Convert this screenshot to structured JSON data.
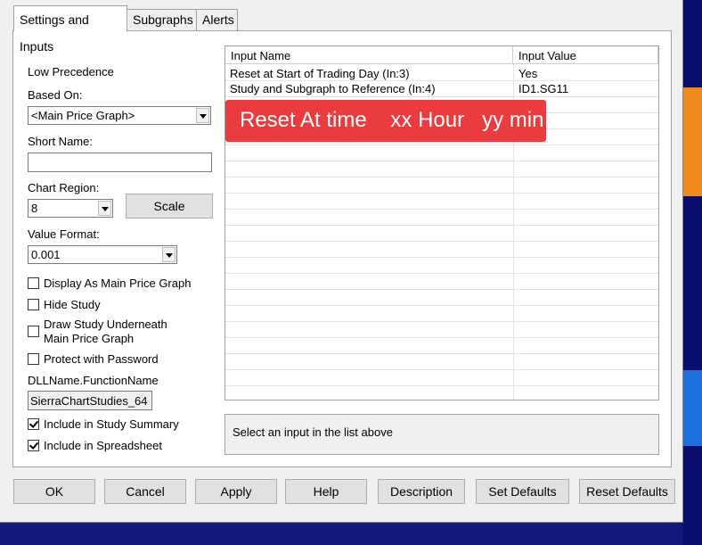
{
  "tabs": [
    "Settings and Inputs",
    "Subgraphs",
    "Alerts"
  ],
  "left": {
    "precedence": "Low Precedence",
    "based_on_label": "Based On:",
    "based_on_value": "<Main Price Graph>",
    "short_name_label": "Short Name:",
    "short_name_value": "",
    "chart_region_label": "Chart Region:",
    "chart_region_value": "8",
    "scale_button": "Scale",
    "value_format_label": "Value Format:",
    "value_format_value": "0.001",
    "checkboxes": [
      {
        "label": "Display As Main Price Graph",
        "checked": false
      },
      {
        "label": "Hide Study",
        "checked": false
      },
      {
        "label": "Draw Study Underneath",
        "label2": "Main Price Graph",
        "checked": false
      },
      {
        "label": "Protect with Password",
        "checked": false
      }
    ],
    "dll_label": "DLLName.FunctionName",
    "dll_value": "SierraChartStudies_64",
    "summary_checkboxes": [
      {
        "label": "Include in Study Summary",
        "checked": true
      },
      {
        "label": "Include in Spreadsheet",
        "checked": true
      }
    ]
  },
  "inputs_table": {
    "headers": [
      "Input Name",
      "Input Value"
    ],
    "rows": [
      {
        "name": "Reset at Start of Trading Day   (In:3)",
        "value": "Yes"
      },
      {
        "name": "Study and Subgraph to Reference   (In:4)",
        "value": "ID1.SG11"
      }
    ]
  },
  "annotation": "Reset At time    xx Hour   yy min",
  "description": "Select an input in the list above",
  "buttons": [
    "OK",
    "Cancel",
    "Apply",
    "Help",
    "Description",
    "Set Defaults",
    "Reset Defaults"
  ],
  "colors": {
    "annotation_bg": "#ec3b3f",
    "background": "#151a7a",
    "chart_orange": "#f08a1c",
    "chart_blue": "#1e6fe0"
  }
}
